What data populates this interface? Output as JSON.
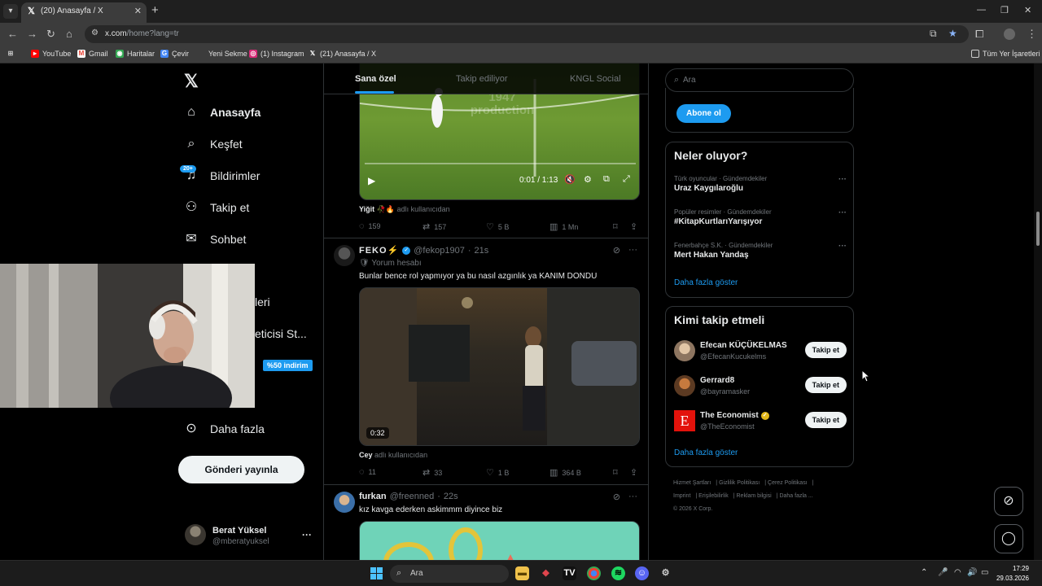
{
  "browser": {
    "tab_title": "(20) Anasayfa / X",
    "url_host": "x.com",
    "url_path": "/home?lang=tr",
    "bookmarks": [
      "YouTube",
      "Gmail",
      "Haritalar",
      "Çevir",
      "Yeni Sekme",
      "(1) Instagram",
      "(21) Anasayfa / X"
    ],
    "all_bookmarks": "Tüm Yer İşaretleri"
  },
  "sidebar": {
    "logo": "𝕏",
    "items": [
      {
        "label": "Anasayfa",
        "icon": "home-icon"
      },
      {
        "label": "Keşfet",
        "icon": "search-icon"
      },
      {
        "label": "Bildirimler",
        "icon": "bell-icon"
      },
      {
        "label": "Takip et",
        "icon": "add-user-icon"
      },
      {
        "label": "Sohbet",
        "icon": "mail-icon"
      }
    ],
    "notif_badge": "20+",
    "partial_items": [
      "leri",
      "eticisi St..."
    ],
    "premium_badge": "%50 indirim",
    "more_label": "Daha fazla",
    "post_button": "Gönderi yayınla",
    "user": {
      "name": "Berat Yüksel",
      "handle": "@mberatyuksel"
    }
  },
  "feed": {
    "tabs": [
      "Sana özel",
      "Takip ediliyor",
      "KNGL Social"
    ],
    "posts": [
      {
        "video_time": "0:01 / 1:13",
        "watermark": "1947 production",
        "caption_name": "Yiğit",
        "caption_emojis": "🥀🔥",
        "caption_suffix": "adlı kullanıcıdan",
        "replies": "159",
        "reposts": "157",
        "likes": "5 B",
        "views": "1 Mn"
      },
      {
        "author": "FEKO⚡",
        "handle": "@fekop1907",
        "time": "21s",
        "sub": "Yorum hesabı",
        "text": "Bunlar bence rol yapmıyor ya bu nasıl azgınlık ya KANIM DONDU",
        "duration": "0:32",
        "caption_name": "Cey",
        "caption_suffix": "adlı kullanıcıdan",
        "replies": "11",
        "reposts": "33",
        "likes": "1 B",
        "views": "364 B"
      },
      {
        "author": "furkan",
        "handle": "@freenned",
        "time": "22s",
        "text": "kız kavga ederken askimmm diyince biz"
      }
    ]
  },
  "right": {
    "search_placeholder": "Ara",
    "subscribe": "Abone ol",
    "trends_title": "Neler oluyor?",
    "trends": [
      {
        "category": "Türk oyuncular · Gündemdekiler",
        "name": "Uraz Kaygılaroğlu"
      },
      {
        "category": "Popüler resimler · Gündemdekiler",
        "name": "#KitapKurtlarıYarışıyor"
      },
      {
        "category": "Fenerbahçe S.K. · Gündemdekiler",
        "name": "Mert Hakan Yandaş"
      }
    ],
    "show_more": "Daha fazla göster",
    "who_to_follow_title": "Kimi takip etmeli",
    "follow": [
      {
        "name": "Efecan KÜÇÜKELMAS",
        "handle": "@EfecanKucukelms",
        "button": "Takip et"
      },
      {
        "name": "Gerrard8",
        "handle": "@bayramasker",
        "button": "Takip et"
      },
      {
        "name": "The Economist",
        "handle": "@TheEconomist",
        "button": "Takip et"
      }
    ],
    "footer": [
      "Hizmet Şartları",
      "Gizlilik Politikası",
      "Çerez Politikası",
      "Imprint",
      "Erişilebilirlik",
      "Reklam bilgisi",
      "Daha fazla ...",
      "© 2026 X Corp."
    ]
  },
  "taskbar": {
    "search": "Ara",
    "time": "17:29",
    "date": "29.03.2026"
  }
}
